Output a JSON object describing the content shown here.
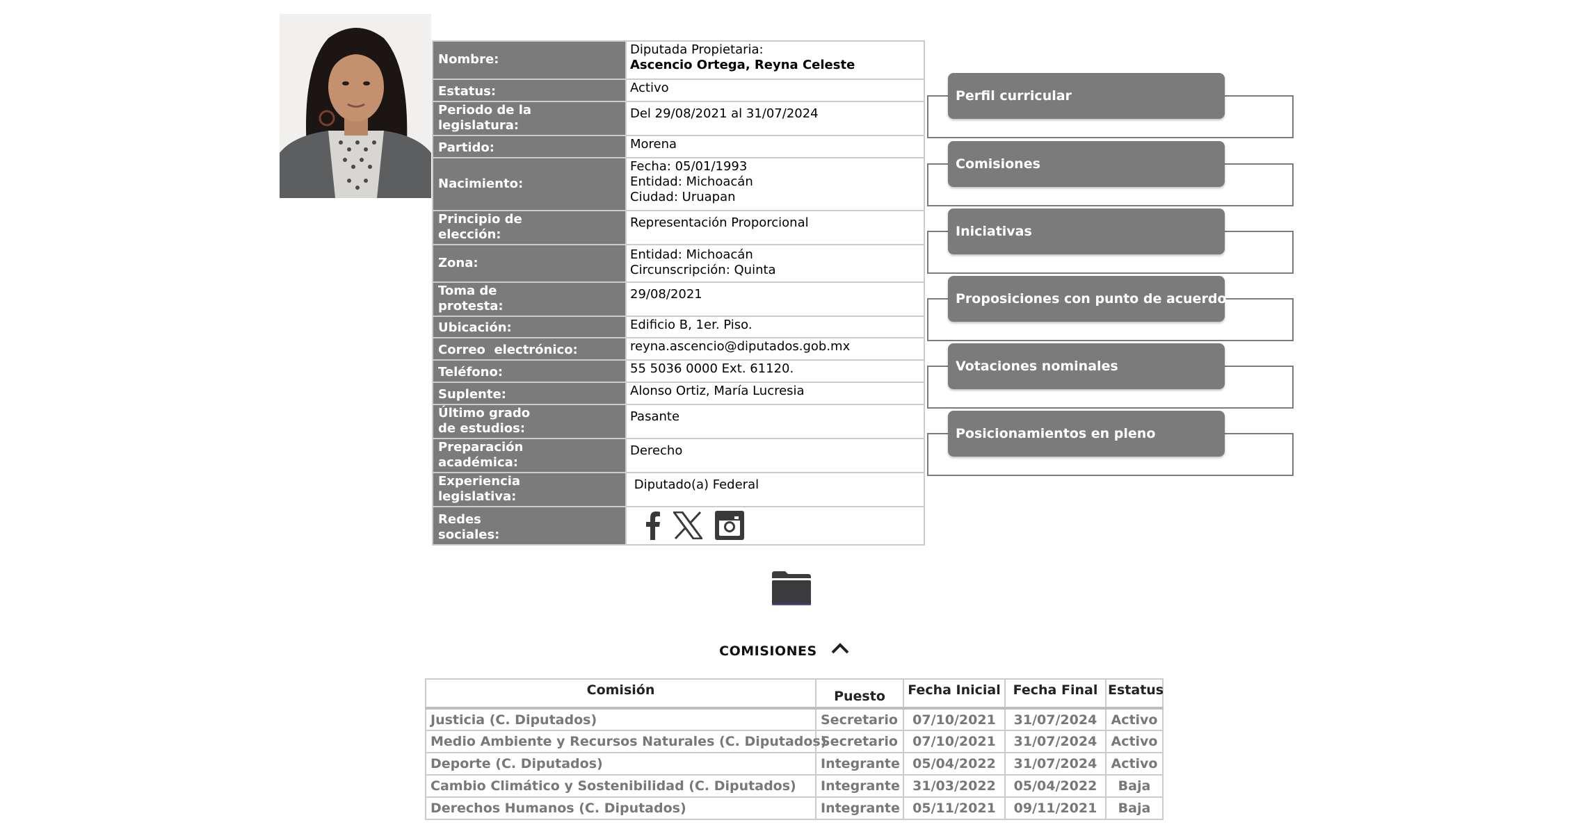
{
  "photo": {
    "alt": "Fotografía de la diputada"
  },
  "profile": {
    "rows": [
      {
        "key": "nombre",
        "label": "Nombre:",
        "lines": [
          "Diputada Propietaria:"
        ],
        "bold_line": "Ascencio Ortega, Reyna Celeste"
      },
      {
        "key": "estatus",
        "label": "Estatus:",
        "lines": [
          "Activo"
        ]
      },
      {
        "key": "periodo",
        "label": "Periodo de la legislatura:",
        "lines": [
          "Del 29/08/2021 al 31/07/2024"
        ]
      },
      {
        "key": "partido",
        "label": "Partido:",
        "lines": [
          "Morena"
        ]
      },
      {
        "key": "nacimiento",
        "label": "Nacimiento:",
        "lines": [
          "Fecha: 05/01/1993",
          "Entidad: Michoacán",
          "Ciudad: Uruapan"
        ]
      },
      {
        "key": "principio",
        "label": "Principio de elección:",
        "lines": [
          "Representación Proporcional"
        ]
      },
      {
        "key": "zona",
        "label": "Zona:",
        "lines": [
          "Entidad: Michoacán",
          "Circunscripción: Quinta"
        ]
      },
      {
        "key": "toma",
        "label": "Toma de protesta:",
        "lines": [
          "29/08/2021"
        ]
      },
      {
        "key": "ubicacion",
        "label": "Ubicación:",
        "lines": [
          "Edificio B, 1er. Piso."
        ]
      },
      {
        "key": "correo",
        "label": "Correo  electrónico:",
        "lines": [
          "reyna.ascencio@diputados.gob.mx"
        ]
      },
      {
        "key": "telefono",
        "label": "Teléfono:",
        "lines": [
          "55 5036 0000 Ext. 61120."
        ]
      },
      {
        "key": "suplente",
        "label": "Suplente:",
        "lines": [
          "Alonso Ortiz, María Lucresia"
        ]
      },
      {
        "key": "grado",
        "label": "Último grado de estudios:",
        "lines": [
          "Pasante"
        ]
      },
      {
        "key": "preparacion",
        "label": "Preparación académica:",
        "lines": [
          "Derecho"
        ]
      },
      {
        "key": "experiencia",
        "label": "Experiencia legislativa:",
        "lines": [
          " Diputado(a) Federal"
        ]
      },
      {
        "key": "redes",
        "label": "Redes sociales:",
        "social": [
          "facebook-icon",
          "x-twitter-icon",
          "instagram-icon"
        ]
      }
    ],
    "labels_split": {
      "periodo": [
        "Periodo de la",
        "legislatura:"
      ],
      "principio": [
        "Principio de",
        "elección:"
      ],
      "toma": [
        "Toma de",
        "protesta:"
      ],
      "grado": [
        "Último grado",
        "de estudios:"
      ],
      "preparacion": [
        "Preparación",
        "académica:"
      ],
      "experiencia": [
        "Experiencia",
        "legislativa:"
      ],
      "redes": [
        "Redes",
        "sociales:"
      ]
    }
  },
  "nav": [
    {
      "label": "Perfil curricular"
    },
    {
      "label": "Comisiones"
    },
    {
      "label": "Iniciativas"
    },
    {
      "label": "Proposiciones con punto de acuerdo"
    },
    {
      "label": "Votaciones nominales"
    },
    {
      "label": "Posicionamientos en pleno"
    }
  ],
  "folder_icon": "folder-icon",
  "comisiones": {
    "heading": "COMISIONES",
    "columns": [
      "Comisión",
      "Puesto",
      "Fecha Inicial",
      "Fecha Final",
      "Estatus"
    ],
    "rows": [
      [
        "Justicia (C. Diputados)",
        "Secretario",
        "07/10/2021",
        "31/07/2024",
        "Activo"
      ],
      [
        "Medio Ambiente y Recursos Naturales (C. Diputados)",
        "Secretario",
        "07/10/2021",
        "31/07/2024",
        "Activo"
      ],
      [
        "Deporte (C. Diputados)",
        "Integrante",
        "05/04/2022",
        "31/07/2024",
        "Activo"
      ],
      [
        "Cambio Climático y Sostenibilidad (C. Diputados)",
        "Integrante",
        "31/03/2022",
        "05/04/2022",
        "Baja"
      ],
      [
        "Derechos Humanos (C. Diputados)",
        "Integrante",
        "05/11/2021",
        "09/11/2021",
        "Baja"
      ]
    ]
  },
  "colors": {
    "label_bg": "#7b7b7b",
    "border": "#cccccc",
    "nav_bg": "#7b7b7b",
    "table_text": "#787878"
  }
}
